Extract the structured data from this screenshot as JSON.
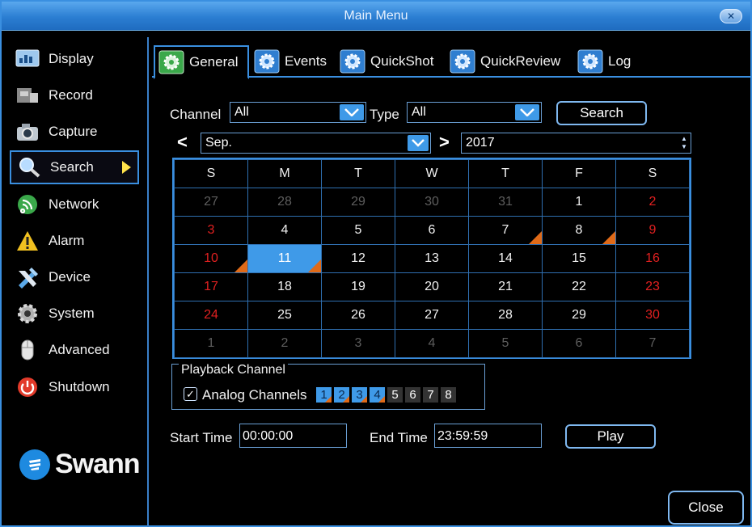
{
  "window": {
    "title": "Main Menu",
    "close_glyph": "✕"
  },
  "sidebar": {
    "items": [
      {
        "label": "Display",
        "icon": "display-icon"
      },
      {
        "label": "Record",
        "icon": "record-icon"
      },
      {
        "label": "Capture",
        "icon": "camera-icon"
      },
      {
        "label": "Search",
        "icon": "search-icon",
        "active": true
      },
      {
        "label": "Network",
        "icon": "network-icon"
      },
      {
        "label": "Alarm",
        "icon": "alarm-icon"
      },
      {
        "label": "Device",
        "icon": "device-icon"
      },
      {
        "label": "System",
        "icon": "gear-icon"
      },
      {
        "label": "Advanced",
        "icon": "mouse-icon"
      },
      {
        "label": "Shutdown",
        "icon": "power-icon"
      }
    ],
    "logo": "Swann"
  },
  "tabs": [
    {
      "label": "General",
      "active": true
    },
    {
      "label": "Events"
    },
    {
      "label": "QuickShot"
    },
    {
      "label": "QuickReview"
    },
    {
      "label": "Log"
    }
  ],
  "filters": {
    "channel_label": "Channel",
    "channel_value": "All",
    "type_label": "Type",
    "type_value": "All",
    "search_button": "Search"
  },
  "month_nav": {
    "prev": "<",
    "next": ">",
    "month": "Sep.",
    "year": "2017"
  },
  "calendar": {
    "weekdays": [
      "S",
      "M",
      "T",
      "W",
      "T",
      "F",
      "S"
    ],
    "weeks": [
      [
        "27",
        "28",
        "29",
        "30",
        "31",
        "1",
        "2"
      ],
      [
        "3",
        "4",
        "5",
        "6",
        "7",
        "8",
        "9"
      ],
      [
        "10",
        "11",
        "12",
        "13",
        "14",
        "15",
        "16"
      ],
      [
        "17",
        "18",
        "19",
        "20",
        "21",
        "22",
        "23"
      ],
      [
        "24",
        "25",
        "26",
        "27",
        "28",
        "29",
        "30"
      ],
      [
        "1",
        "2",
        "3",
        "4",
        "5",
        "6",
        "7"
      ]
    ],
    "selected_day": "11",
    "recorded_days": [
      "7",
      "8",
      "10",
      "11"
    ]
  },
  "playback": {
    "title": "Playback Channel",
    "checkbox_label": "Analog Channels",
    "checked": true,
    "channels": [
      {
        "n": "1",
        "on": true,
        "rec": true
      },
      {
        "n": "2",
        "on": true,
        "rec": true
      },
      {
        "n": "3",
        "on": true,
        "rec": true
      },
      {
        "n": "4",
        "on": true,
        "rec": true
      },
      {
        "n": "5",
        "on": false,
        "rec": false
      },
      {
        "n": "6",
        "on": false,
        "rec": false
      },
      {
        "n": "7",
        "on": false,
        "rec": false
      },
      {
        "n": "8",
        "on": false,
        "rec": false
      }
    ]
  },
  "time": {
    "start_label": "Start Time",
    "start_value": "00:00:00",
    "end_label": "End Time",
    "end_value": "23:59:59",
    "play_button": "Play"
  },
  "close_button": "Close",
  "colors": {
    "accent": "#3f9ae8",
    "weekend": "#e12020",
    "record_marker": "#e06a18",
    "title_bar": "#2b7ed2"
  }
}
